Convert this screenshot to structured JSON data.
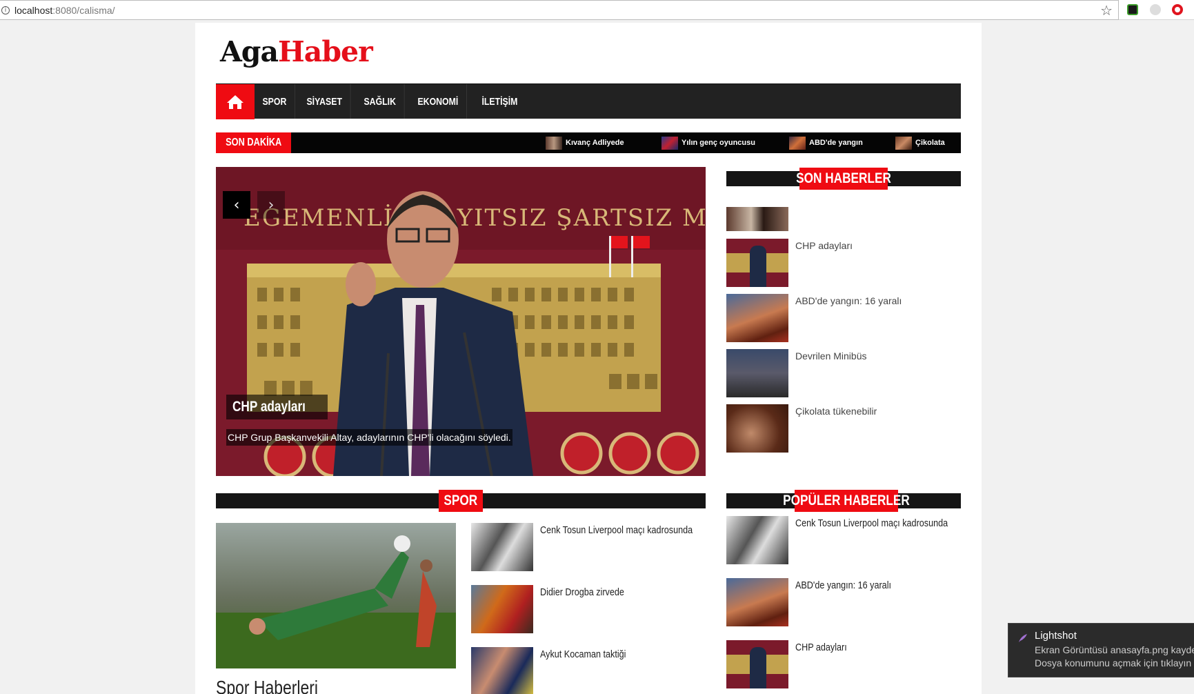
{
  "browser": {
    "url_host": "localhost",
    "url_rest": ":8080/calisma/",
    "info_glyph": "i",
    "star_glyph": "☆"
  },
  "site": {
    "logo_a": "Aga",
    "logo_b": "Haber",
    "brand_color": "#e50f1a"
  },
  "nav": {
    "home_icon": "home-icon",
    "items": [
      "SPOR",
      "SİYASET",
      "SAĞLIK",
      "EKONOMİ",
      "İLETİŞİM"
    ]
  },
  "ticker": {
    "label": "SON DAKİKA",
    "items": [
      "Kıvanç Adliyede",
      "Yılın genç oyuncusu",
      "ABD'de yangın",
      "Çikolata"
    ]
  },
  "slider": {
    "title": "CHP adayları",
    "text": "CHP Grup Başkanvekili Altay, adaylarının CHP'li olacağını söyledi.",
    "banner": "EGEMENLİK KAYITSIZ ŞARTSIZ MİLLETİNDİR",
    "prev_glyph": "‹",
    "next_glyph": "›"
  },
  "son_haberler": {
    "label": "SON HABERLER",
    "items": [
      "",
      "CHP adayları",
      "ABD'de yangın: 16 yaralı",
      "Devrilen Minibüs",
      "Çikolata tükenebilir"
    ]
  },
  "spor": {
    "label": "SPOR",
    "caption": "Spor Haberleri",
    "items": [
      "Cenk Tosun Liverpool maçı kadrosunda",
      "Didier Drogba zirvede",
      "Aykut Kocaman taktiği"
    ]
  },
  "populer": {
    "label": "POPÜLER HABERLER",
    "items": [
      "Cenk Tosun Liverpool maçı kadrosunda",
      "ABD'de yangın: 16 yaralı",
      "CHP adayları"
    ]
  },
  "toast": {
    "title": "Lightshot",
    "line1": "Ekran Görüntüsü anasayfa.png kaydedildi",
    "line2": "Dosya konumunu açmak için tıklayın"
  }
}
